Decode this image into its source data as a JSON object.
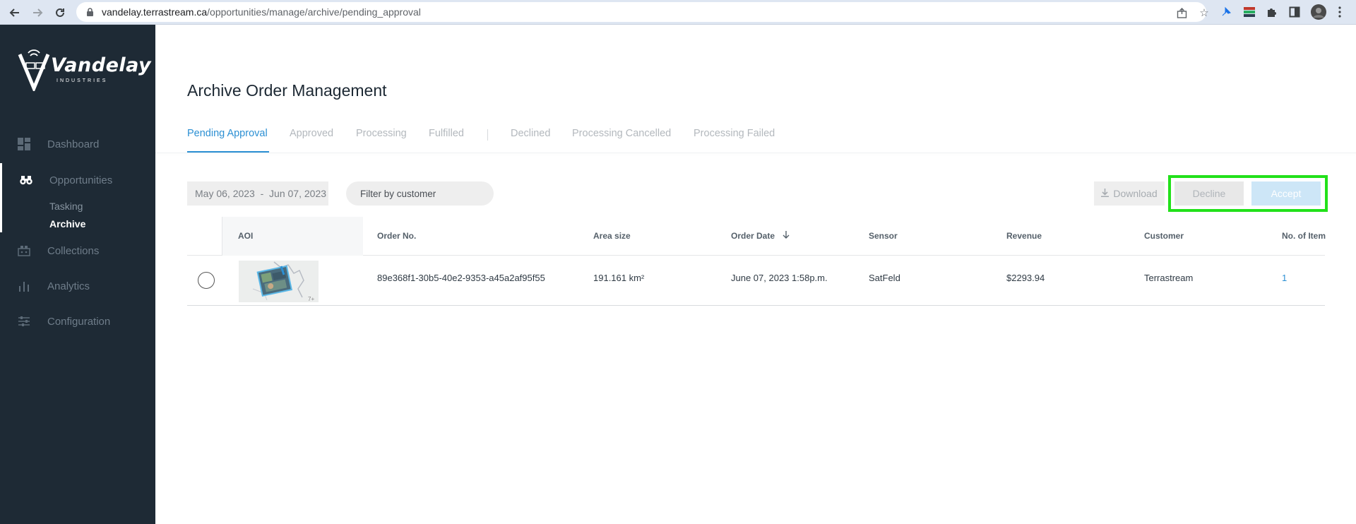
{
  "browser": {
    "url_host": "vandelay.terrastream.ca",
    "url_path": "/opportunities/manage/archive/pending_approval"
  },
  "brand": {
    "name": "Vandelay",
    "sub": "INDUSTRIES"
  },
  "sidebar": {
    "items": [
      {
        "label": "Dashboard",
        "icon": "dashboard-icon"
      },
      {
        "label": "Opportunities",
        "icon": "binoculars-icon"
      },
      {
        "label": "Collections",
        "icon": "collections-icon"
      },
      {
        "label": "Analytics",
        "icon": "bar-chart-icon"
      },
      {
        "label": "Configuration",
        "icon": "sliders-icon"
      }
    ],
    "sub_items": [
      {
        "label": "Tasking"
      },
      {
        "label": "Archive"
      }
    ]
  },
  "page": {
    "title": "Archive Order Management"
  },
  "tabs": [
    {
      "label": "Pending Approval",
      "active": true
    },
    {
      "label": "Approved"
    },
    {
      "label": "Processing"
    },
    {
      "label": "Fulfilled"
    },
    {
      "label": "Declined"
    },
    {
      "label": "Processing Cancelled"
    },
    {
      "label": "Processing Failed"
    }
  ],
  "toolbar": {
    "date_range": "May 06, 2023  -  Jun 07, 2023",
    "filter_placeholder": "Filter by customer",
    "download_label": "Download",
    "decline_label": "Decline",
    "accept_label": "Accept"
  },
  "table": {
    "columns": [
      "AOI",
      "Order No.",
      "Area size",
      "Order Date",
      "Sensor",
      "Revenue",
      "Customer",
      "No. of Item"
    ],
    "rows": [
      {
        "order_no": "89e368f1-30b5-40e2-9353-a45a2af95f55",
        "area_size": "191.161 km²",
        "order_date": "June 07, 2023 1:58p.m.",
        "sensor": "SatFeld",
        "revenue": "$2293.94",
        "customer": "Terrastream",
        "items": "1",
        "thumb_label": "7+"
      }
    ]
  },
  "colors": {
    "sidebar_bg": "#1e2a35",
    "accent": "#2b8fd3",
    "highlight": "#22e11a"
  }
}
